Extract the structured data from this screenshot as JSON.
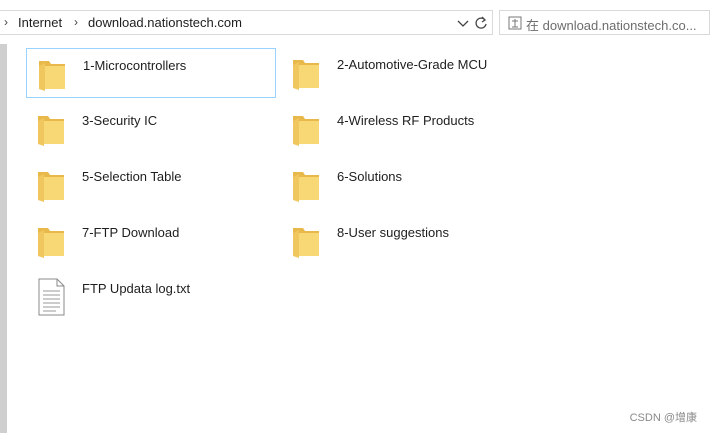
{
  "address_bar": {
    "crumbs": [
      "Internet",
      "download.nationstech.com"
    ]
  },
  "search": {
    "placeholder": "在 download.nationstech.co..."
  },
  "items": [
    {
      "label": "1-Microcontrollers",
      "type": "folder",
      "selected": true
    },
    {
      "label": "2-Automotive-Grade MCU",
      "type": "folder"
    },
    {
      "label": "3-Security IC",
      "type": "folder"
    },
    {
      "label": "4-Wireless RF Products",
      "type": "folder"
    },
    {
      "label": "5-Selection Table",
      "type": "folder"
    },
    {
      "label": "6-Solutions",
      "type": "folder"
    },
    {
      "label": "7-FTP Download",
      "type": "folder"
    },
    {
      "label": "8-User suggestions",
      "type": "folder"
    },
    {
      "label": "FTP Updata log.txt",
      "type": "text-file"
    }
  ],
  "watermark": "CSDN @增康",
  "colors": {
    "folder": "#f8d775",
    "selection_border": "#99d1ff"
  }
}
